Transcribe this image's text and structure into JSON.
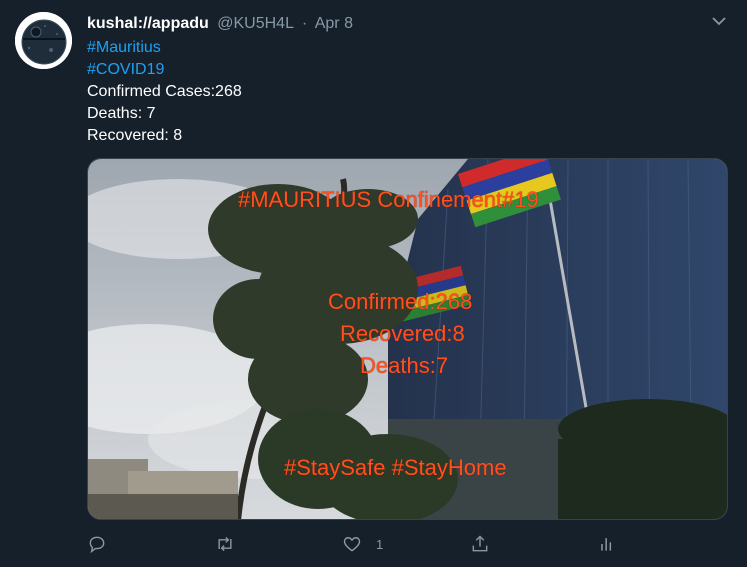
{
  "tweet": {
    "display_name": "kushal://appadu",
    "handle": "@KU5H4L",
    "separator": "·",
    "date": "Apr 8",
    "lines": {
      "hashtag1": "#Mauritius",
      "hashtag2": "#COVID19",
      "confirmed": "Confirmed Cases:268",
      "deaths": "Deaths: 7",
      "recovered": "Recovered: 8"
    },
    "image_text": {
      "title": "#MAURITIUS Confinement#19",
      "confirmed": "Confirmed:268",
      "recovered": "Recovered:8",
      "deaths": "Deaths:7",
      "tags": "#StaySafe #StayHome"
    },
    "actions": {
      "reply_icon": "reply-icon",
      "retweet_icon": "retweet-icon",
      "like_icon": "heart-icon",
      "like_count": "1",
      "share_icon": "share-icon",
      "analytics_icon": "analytics-icon"
    }
  },
  "colors": {
    "background": "#15202b",
    "link": "#1da1f2",
    "secondary_text": "#8899a6",
    "overlay_text": "#ff4f1f"
  }
}
